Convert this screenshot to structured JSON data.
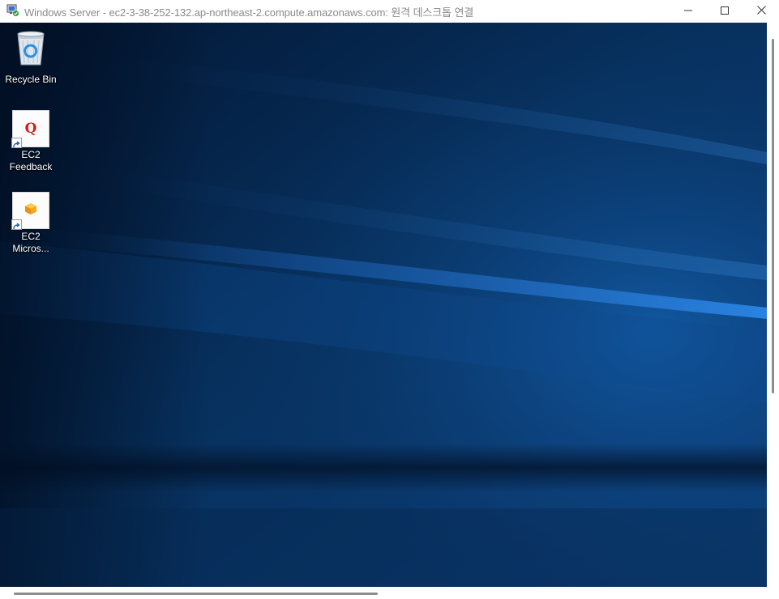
{
  "window": {
    "title": "Windows Server - ec2-3-38-252-132.ap-northeast-2.compute.amazonaws.com: 원격 데스크톱 연결",
    "app_icon": "remote-desktop-icon",
    "controls": {
      "minimize": "minimize-icon",
      "maximize": "maximize-icon",
      "close": "close-icon"
    }
  },
  "desktop": {
    "wallpaper_colors": {
      "dark": "#03142c",
      "mid": "#0a3a72",
      "light": "#1d6fc9"
    },
    "icons": [
      {
        "label": "Recycle Bin",
        "icon": "recycle-bin-icon"
      },
      {
        "label": "EC2\nFeedback",
        "icon": "ec2-feedback-icon"
      },
      {
        "label": "EC2\nMicros...",
        "icon": "ec2-microsoft-icon"
      }
    ]
  }
}
